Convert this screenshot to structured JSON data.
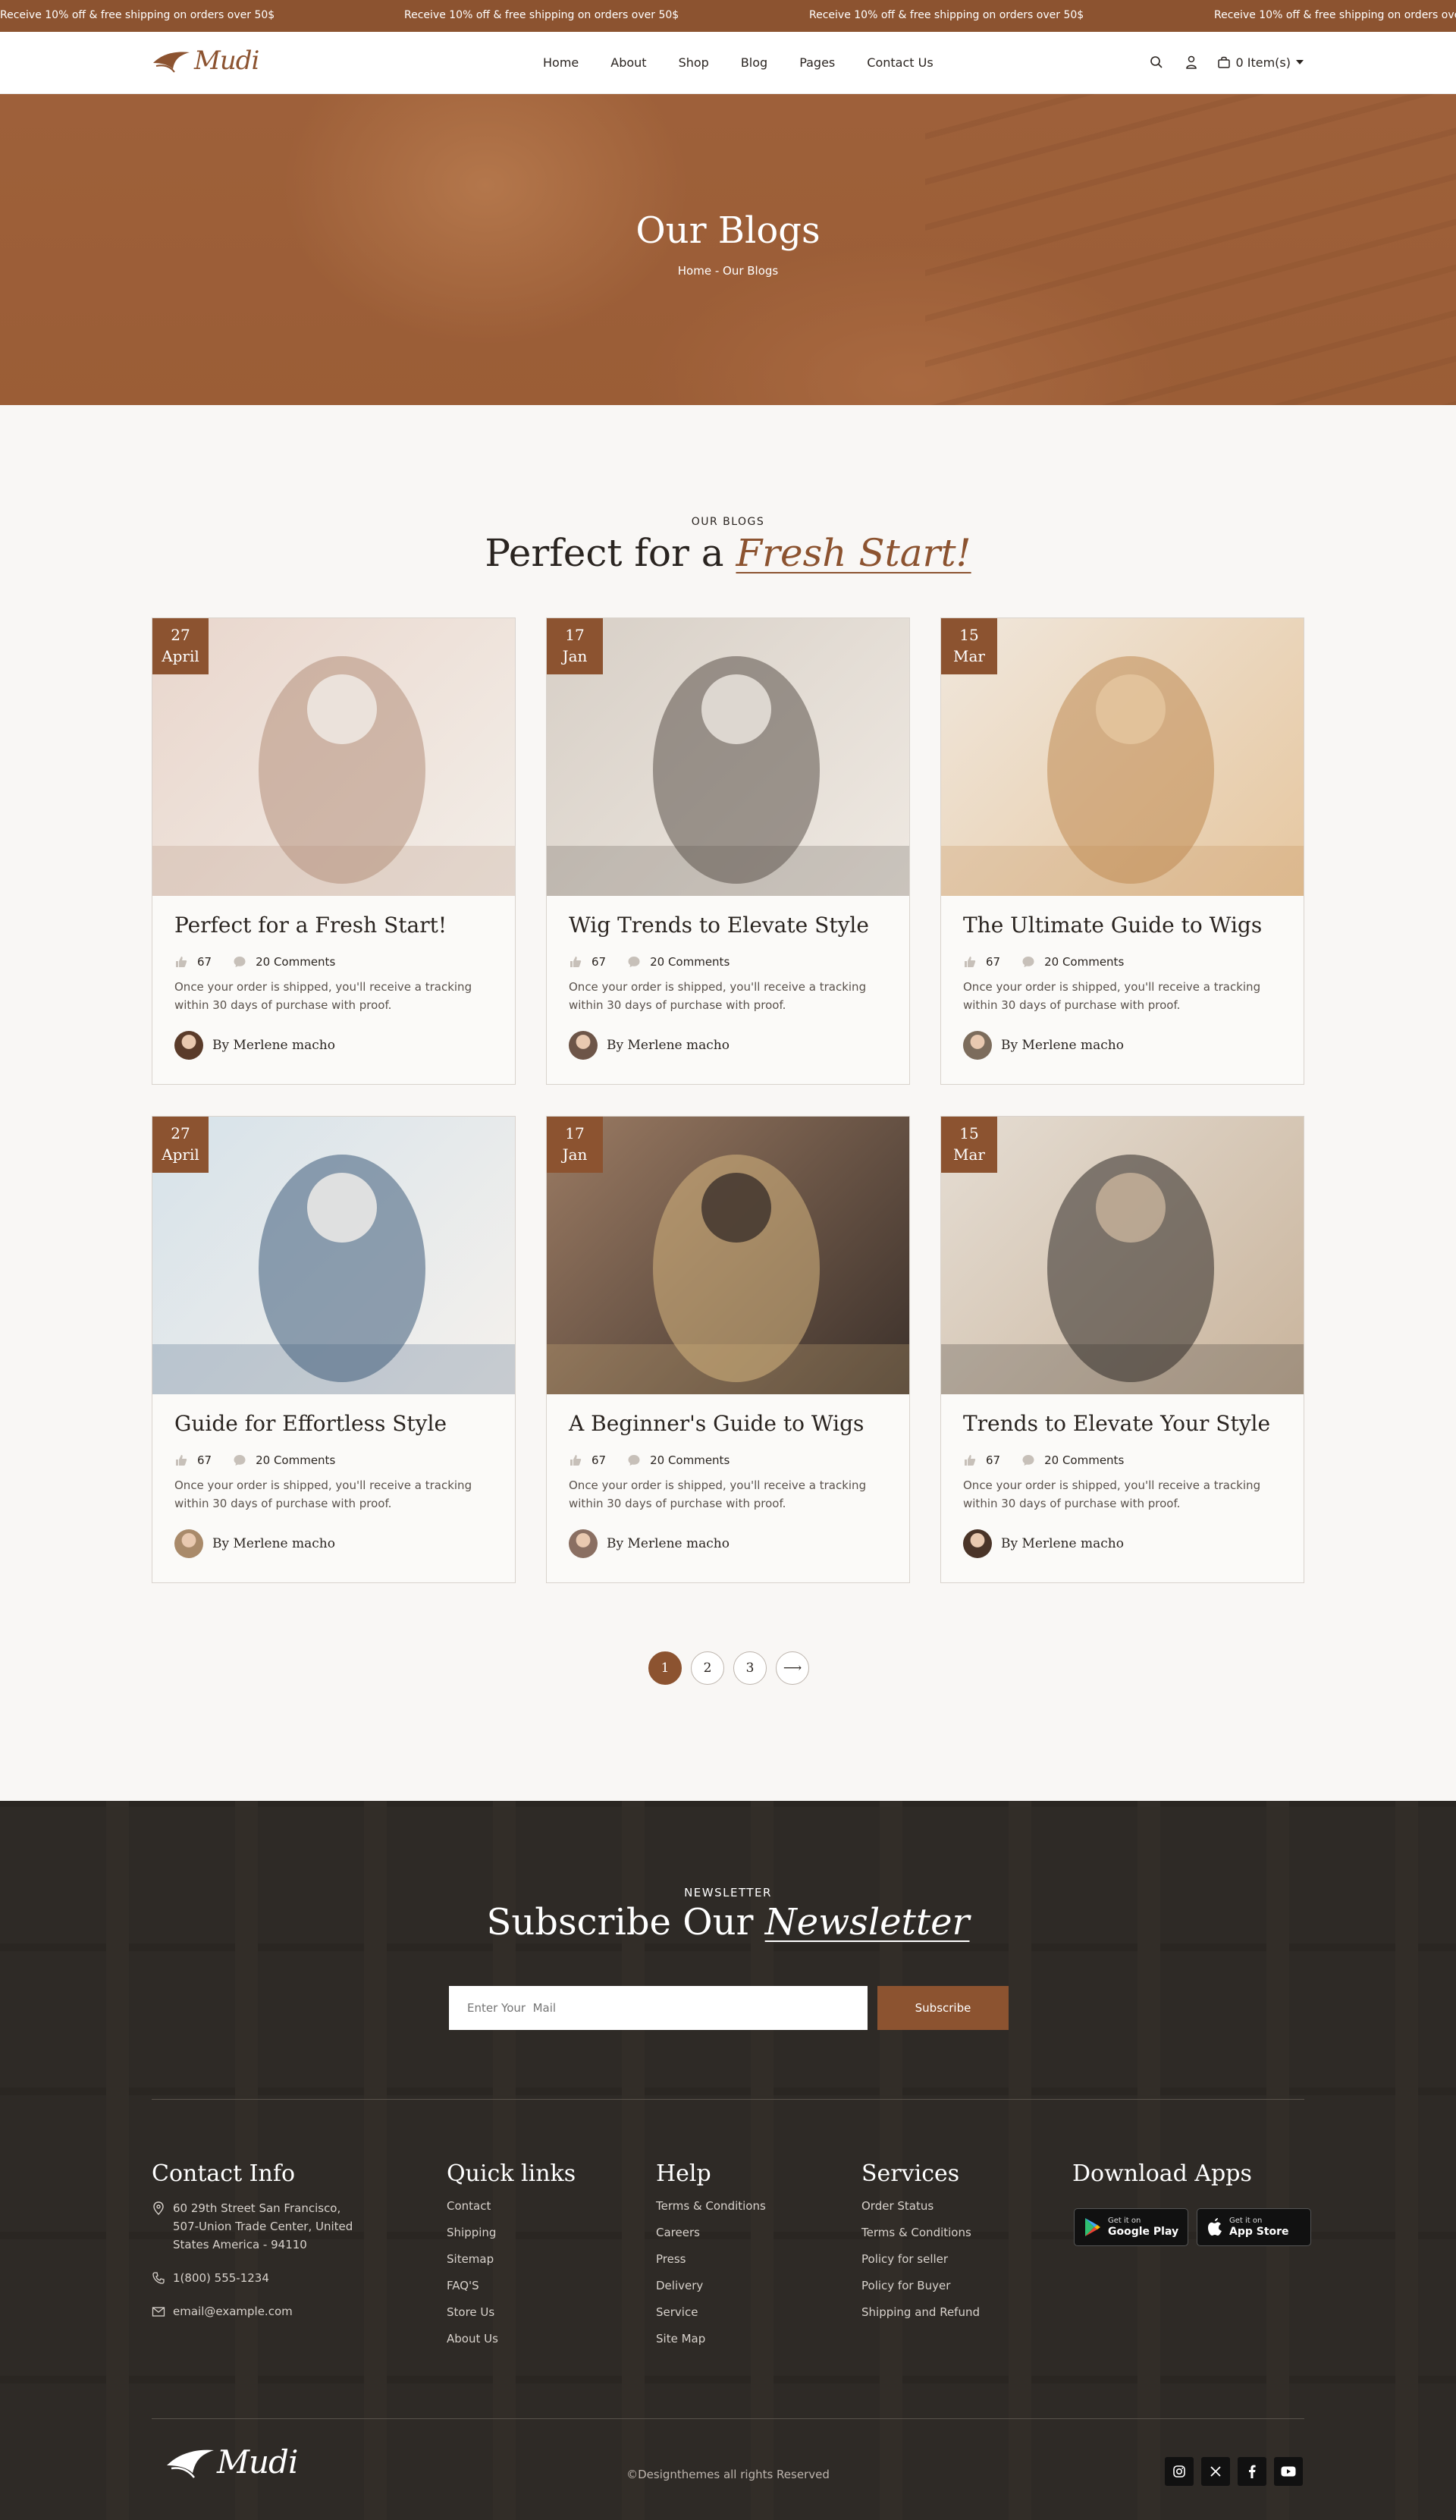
{
  "announcement": {
    "text": "Receive 10% off & free shipping on orders over 50$"
  },
  "header": {
    "logo_text": "Mudi",
    "nav": [
      {
        "label": "Home"
      },
      {
        "label": "About"
      },
      {
        "label": "Shop"
      },
      {
        "label": "Blog"
      },
      {
        "label": "Pages"
      },
      {
        "label": "Contact Us"
      }
    ],
    "cart_label": "0 Item(s)"
  },
  "hero": {
    "title": "Our Blogs",
    "breadcrumb": "Home - Our Blogs"
  },
  "blogs": {
    "eyebrow": "OUR BLOGS",
    "title_plain": "Perfect for a ",
    "title_accent": "Fresh Start!",
    "posts": [
      {
        "day": "27",
        "month": "April",
        "title": "Perfect for a Fresh Start!",
        "likes": "67",
        "comments": "20 Comments",
        "excerpt": "Once your order is shipped, you'll receive a tracking within 30 days of purchase with proof.",
        "author": "By Merlene macho"
      },
      {
        "day": "17",
        "month": "Jan",
        "title": "Wig Trends to Elevate Style",
        "likes": "67",
        "comments": "20 Comments",
        "excerpt": "Once your order is shipped, you'll receive a tracking within 30 days of purchase with proof.",
        "author": "By Merlene macho"
      },
      {
        "day": "15",
        "month": "Mar",
        "title": "The Ultimate Guide to Wigs",
        "likes": "67",
        "comments": "20 Comments",
        "excerpt": "Once your order is shipped, you'll receive a tracking within 30 days of purchase with proof.",
        "author": "By Merlene macho"
      },
      {
        "day": "27",
        "month": "April",
        "title": "Guide for Effortless Style",
        "likes": "67",
        "comments": "20 Comments",
        "excerpt": "Once your order is shipped, you'll receive a tracking within 30 days of purchase with proof.",
        "author": "By Merlene macho"
      },
      {
        "day": "17",
        "month": "Jan",
        "title": "A Beginner's Guide to Wigs",
        "likes": "67",
        "comments": "20 Comments",
        "excerpt": "Once your order is shipped, you'll receive a tracking within 30 days of purchase with proof.",
        "author": "By Merlene macho"
      },
      {
        "day": "15",
        "month": "Mar",
        "title": "Trends to Elevate Your Style",
        "likes": "67",
        "comments": "20 Comments",
        "excerpt": "Once your order is shipped, you'll receive a tracking within 30 days of purchase with proof.",
        "author": "By Merlene macho"
      }
    ]
  },
  "pagination": {
    "pages": [
      "1",
      "2",
      "3"
    ],
    "next": "⟶",
    "current": "1"
  },
  "newsletter": {
    "eyebrow": "NEWSLETTER",
    "title_plain": "Subscribe Our ",
    "title_accent": "Newsletter",
    "placeholder": "Enter Your  Mail",
    "button": "Subscribe"
  },
  "footer": {
    "contact": {
      "heading": "Contact Info",
      "address": "60 29th Street San Francisco, 507-Union Trade Center, United States America - 94110",
      "phone": "1(800) 555-1234",
      "email": "email@example.com"
    },
    "quick_links": {
      "heading": "Quick links",
      "items": [
        "Contact",
        "Shipping",
        "Sitemap",
        "FAQ'S",
        "Store Us",
        "About Us"
      ]
    },
    "help": {
      "heading": "Help",
      "items": [
        "Terms & Conditions",
        "Careers",
        "Press",
        "Delivery",
        "Service",
        "Site Map"
      ]
    },
    "services": {
      "heading": "Services",
      "items": [
        "Order Status",
        "Terms & Conditions",
        "Policy for seller",
        "Policy for Buyer",
        "Shipping and Refund"
      ]
    },
    "apps": {
      "heading": "Download Apps",
      "google_small": "Get it on",
      "google_big": "Google Play",
      "apple_small": "Get it on",
      "apple_big": "App Store"
    },
    "logo_text": "Mudi",
    "copyright": "©Designthemes all rights Reserved"
  },
  "colors": {
    "brand": "#8c5330",
    "footer_bg": "#2e2a26",
    "page_bg": "#f9f7f5"
  }
}
